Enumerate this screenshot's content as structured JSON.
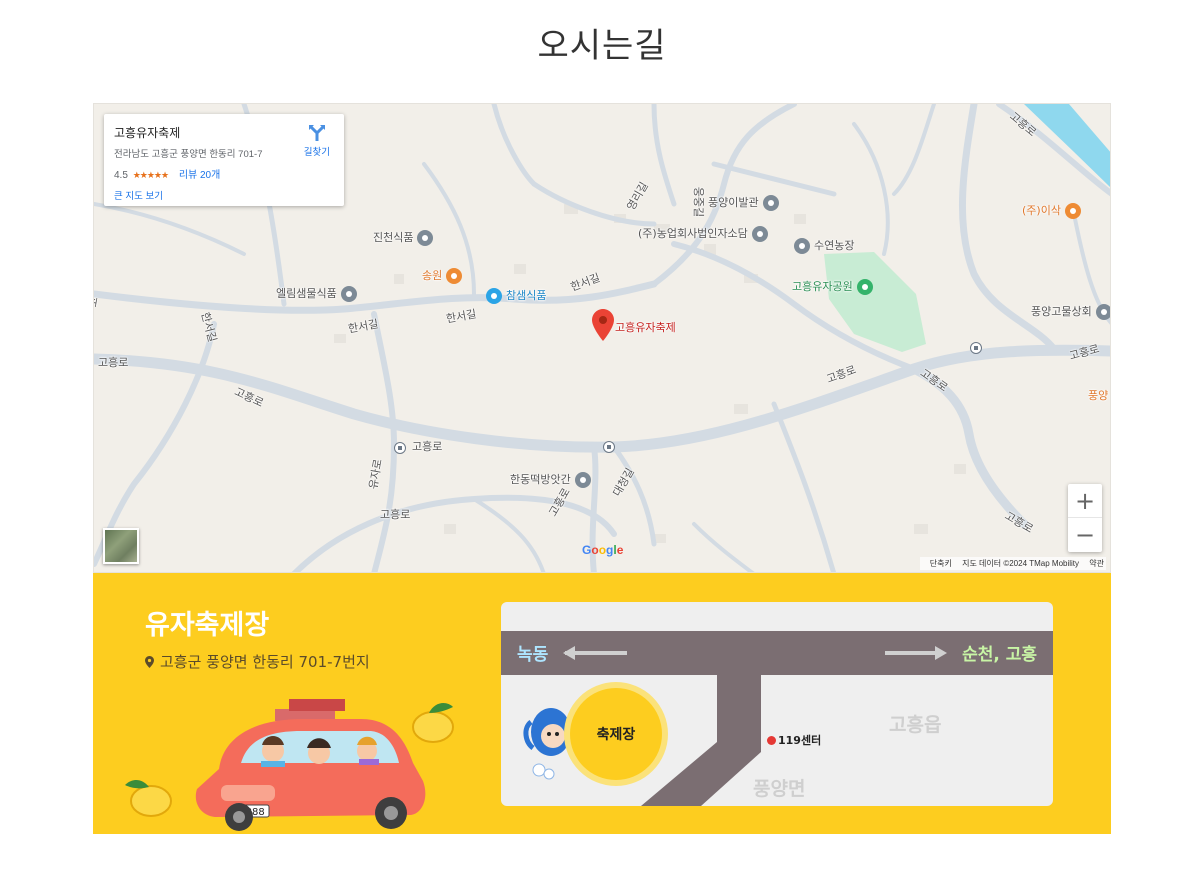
{
  "page": {
    "title": "오시는길"
  },
  "map": {
    "info_card": {
      "name": "고흥유자축제",
      "address": "전라남도 고흥군 풍양면 한동리 701-7",
      "rating": "4.5",
      "stars": "★★★★★",
      "reviews": "리뷰 20개",
      "larger_map": "큰 지도 보기",
      "directions": "길찾기"
    },
    "marker_label": "고흥유자축제",
    "roads": {
      "goheung_ro_1": "고흥로",
      "goheung_ro_2": "고흥로",
      "goheung_ro_3": "고흥로",
      "goheung_ro_4": "고흥로",
      "goheung_ro_5": "고흥로",
      "goheung_ro_6": "고흥로",
      "goheung_ro_7": "고흥로",
      "goheung_ro_8": "고흥로",
      "goheung_ro_9": "고흥로",
      "goheung_ro_10": "고흥로",
      "goheung_ro_11": "고흥로",
      "goheung_ro_12": "고흥로",
      "hanseo_1": "한서길",
      "hanseo_2": "한서길",
      "hanseo_3": "한서길",
      "hanseo_4": "한서길",
      "yeongri": "영리길",
      "yujaro": "유자로",
      "daecheong": "대청길",
      "ungjung": "웅중길",
      "edge_left": "고"
    },
    "pois": {
      "jincheon": "진천식품",
      "songwon": "송원",
      "chamsaem": "참샘식품",
      "ellim": "엘림샘물식품",
      "pungyang_barber": "풍양이발관",
      "nonghyup": "(주)농업회사법인자소담",
      "suyeon": "수연농장",
      "isak": "(주)이삭",
      "park": "고흥유자공원",
      "pungyang_ginseng": "풍양고물상회",
      "pungyang_edge": "풍양",
      "handong": "한동떡방앗간"
    },
    "google_logo": "Google",
    "attribution": {
      "shortcuts": "단축키",
      "data": "지도 데이터 ©2024 TMap Mobility",
      "terms": "약관"
    },
    "zoom_in": "+",
    "zoom_out": "−"
  },
  "banner": {
    "venue_name": "유자축제장",
    "venue_address": "고흥군 풍양면 한동리 701-7번지",
    "route": {
      "left": "녹동",
      "right": "순천, 고흥",
      "town": "고흥읍",
      "myeon": "풍양면",
      "center": "119센터",
      "venue": "축제장"
    },
    "car_plate": "8888"
  },
  "colors": {
    "banner": "#fdcd1f",
    "marker": "#ea4335",
    "park": "#b7e4c7",
    "river": "#7fd3ea"
  }
}
